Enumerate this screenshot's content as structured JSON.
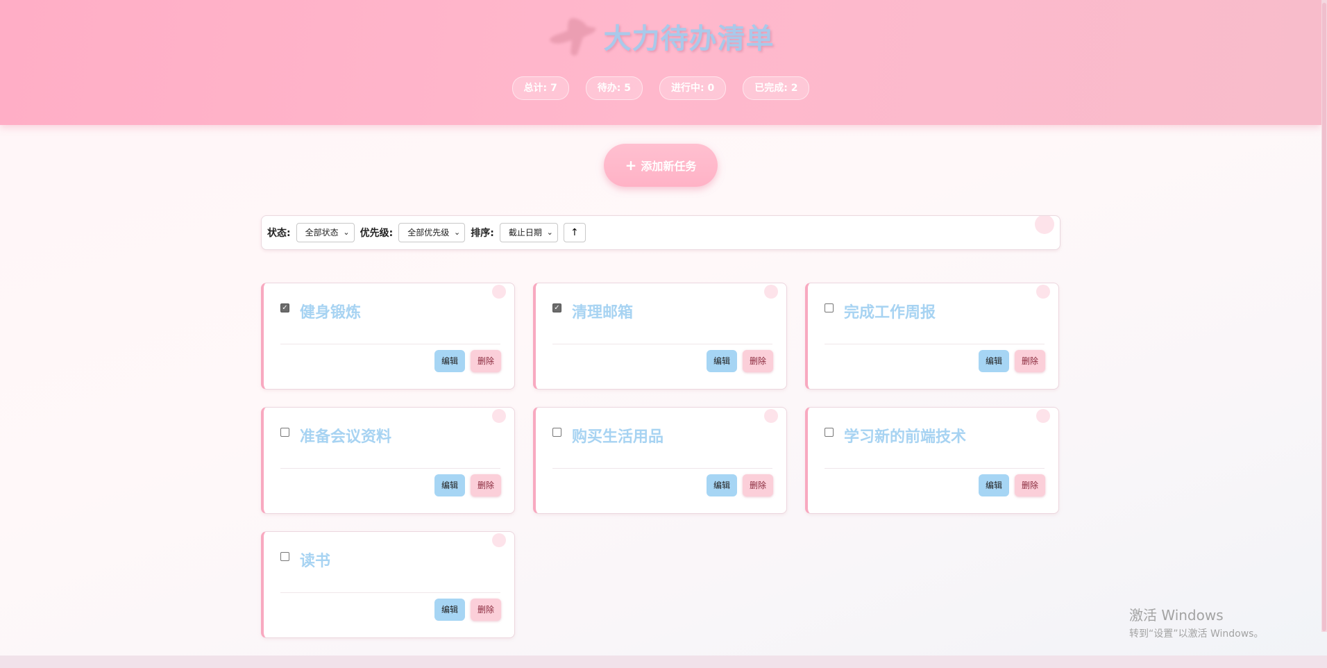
{
  "header": {
    "title": "大力待办清单",
    "stats": [
      {
        "label": "总计: 7"
      },
      {
        "label": "待办: 5"
      },
      {
        "label": "进行中: 0"
      },
      {
        "label": "已完成: 2"
      }
    ]
  },
  "add_button": {
    "icon": "+",
    "label": "添加新任务"
  },
  "filters": {
    "status_label": "状态:",
    "status_value": "全部状态",
    "priority_label": "优先级:",
    "priority_value": "全部优先级",
    "sort_label": "排序:",
    "sort_value": "截止日期",
    "sort_direction": "↑"
  },
  "tasks": [
    {
      "title": "健身锻炼",
      "completed": true,
      "edit_label": "编辑",
      "delete_label": "删除"
    },
    {
      "title": "清理邮箱",
      "completed": true,
      "edit_label": "编辑",
      "delete_label": "删除"
    },
    {
      "title": "完成工作周报",
      "completed": false,
      "edit_label": "编辑",
      "delete_label": "删除"
    },
    {
      "title": "准备会议资料",
      "completed": false,
      "edit_label": "编辑",
      "delete_label": "删除"
    },
    {
      "title": "购买生活用品",
      "completed": false,
      "edit_label": "编辑",
      "delete_label": "删除"
    },
    {
      "title": "学习新的前端技术",
      "completed": false,
      "edit_label": "编辑",
      "delete_label": "删除"
    },
    {
      "title": "读书",
      "completed": false,
      "edit_label": "编辑",
      "delete_label": "删除"
    }
  ],
  "watermark": {
    "title": "激活 Windows",
    "subtitle": "转到“设置”以激活 Windows。"
  },
  "colors": {
    "header_pink": "#ffb1c8",
    "title_blue": "#a9c9ea",
    "task_title_blue": "#a7d3f2",
    "edit_blue": "#a6d5f4",
    "delete_pink": "#fbcfd9",
    "card_accent": "#f8a9c0"
  }
}
